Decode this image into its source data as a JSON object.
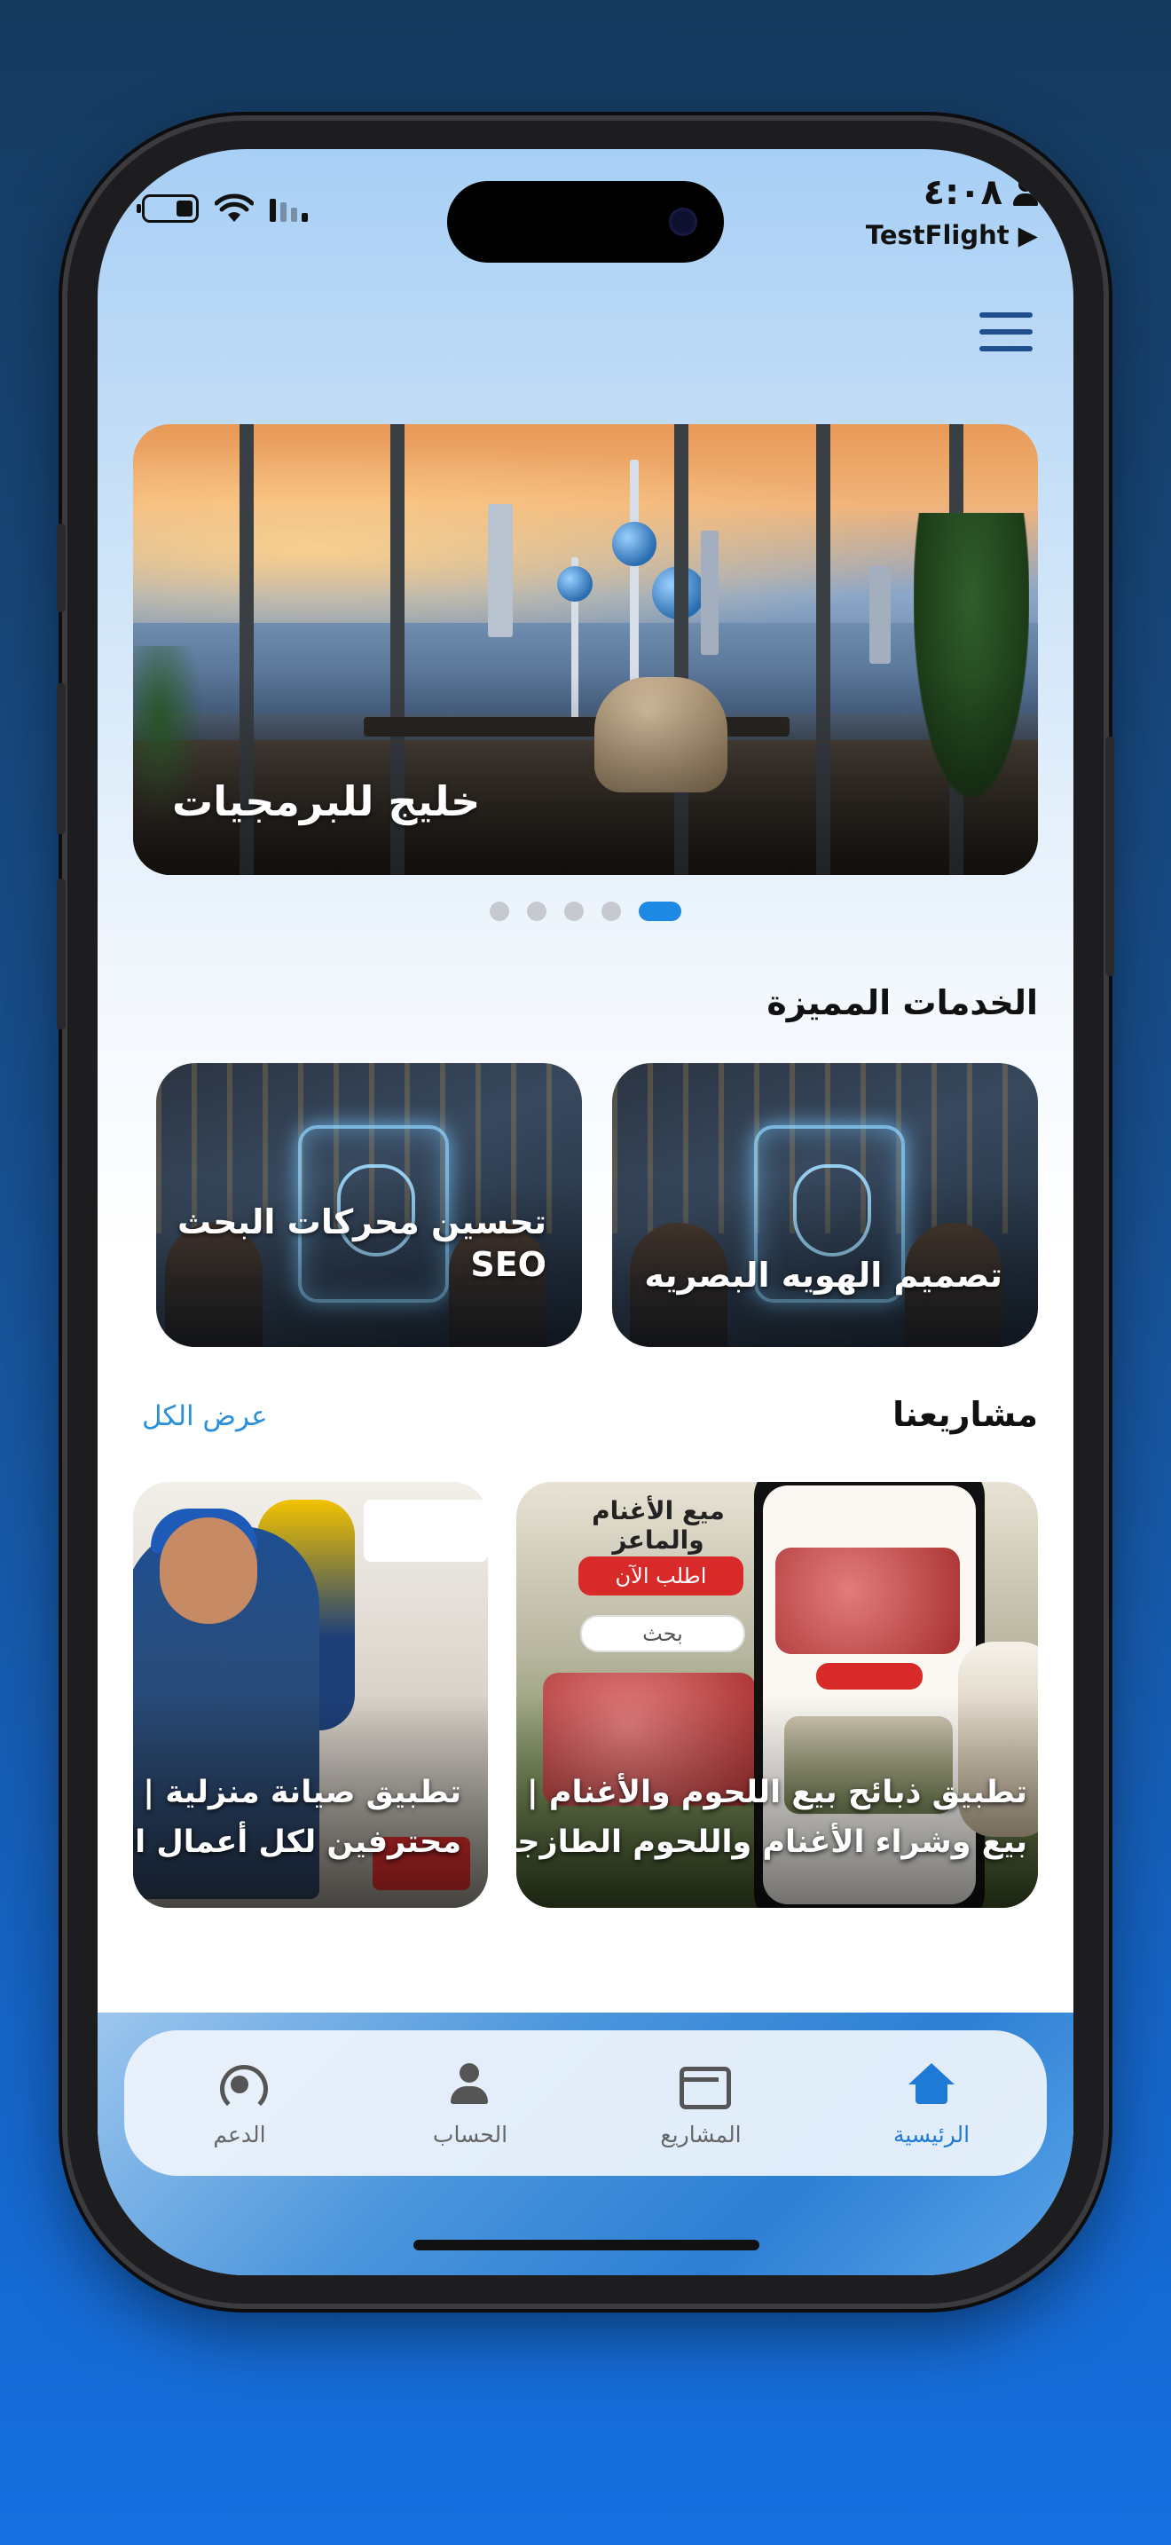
{
  "status_bar": {
    "time": "٤:٠٨",
    "back_app": "TestFlight ▶"
  },
  "header": {
    "menu_icon": "hamburger-menu-icon"
  },
  "hero": {
    "title": "خليج للبرمجيات",
    "slide_count": 5,
    "active_slide_index": 4
  },
  "services": {
    "title": "الخدمات المميزة",
    "items": [
      {
        "label": "تصميم الهويه البصريه"
      },
      {
        "label": "تحسين محركات البحث SEO"
      }
    ]
  },
  "projects": {
    "title": "مشاريعنا",
    "view_all": "عرض الكل",
    "items": [
      {
        "line1": "تطبيق ذبائح بيع اللحوم والأغنام |",
        "line2": "بيع وشراء الأغنام واللحوم الطازجة",
        "mock_header": "ميع الأغنام والماعز",
        "mock_button": "اطلب الآن",
        "mock_search": "بحث"
      },
      {
        "line1": "تطبيق صيانة منزلية | فنيين",
        "line2": "محترفين لكل أعمال الصيانة"
      }
    ]
  },
  "tab_bar": {
    "items": [
      {
        "label": "الرئيسية",
        "icon": "home-icon",
        "active": true
      },
      {
        "label": "المشاريع",
        "icon": "card-icon",
        "active": false
      },
      {
        "label": "الحساب",
        "icon": "person-icon",
        "active": false
      },
      {
        "label": "الدعم",
        "icon": "support-icon",
        "active": false
      }
    ]
  },
  "colors": {
    "accent": "#1f7ad6",
    "link": "#2a8fd8",
    "indicator_active": "#1e88e5",
    "indicator_inactive": "#c6c9cf"
  }
}
